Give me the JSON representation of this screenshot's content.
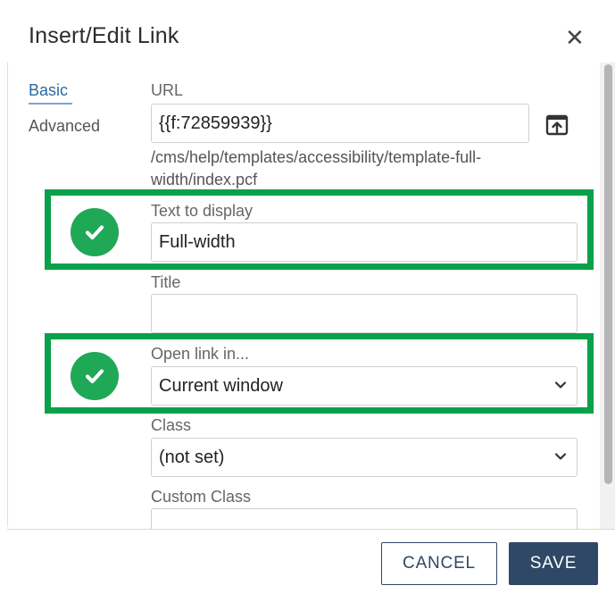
{
  "dialog": {
    "title": "Insert/Edit Link",
    "close_glyph": "✕"
  },
  "tabs": [
    {
      "label": "Basic",
      "active": true
    },
    {
      "label": "Advanced",
      "active": false
    }
  ],
  "fields": {
    "url": {
      "label": "URL",
      "value": "{{f:72859939}}",
      "path": "/cms/help/templates/accessibility/template-full-width/index.pcf"
    },
    "text_to_display": {
      "label": "Text to display",
      "value": "Full-width"
    },
    "title": {
      "label": "Title",
      "value": ""
    },
    "open_link_in": {
      "label": "Open link in...",
      "value": "Current window"
    },
    "class": {
      "label": "Class",
      "value": "(not set)"
    },
    "custom_class": {
      "label": "Custom Class",
      "value": ""
    }
  },
  "buttons": {
    "cancel": "CANCEL",
    "save": "SAVE"
  },
  "colors": {
    "highlight": "#0aa14b",
    "check": "#1fa855",
    "primary": "#2f4865",
    "link": "#2c6aa0"
  },
  "icons": {
    "close": "close-icon",
    "browse": "upload-browse-icon",
    "check": "check-circle-icon",
    "chevron": "chevron-down-icon"
  }
}
